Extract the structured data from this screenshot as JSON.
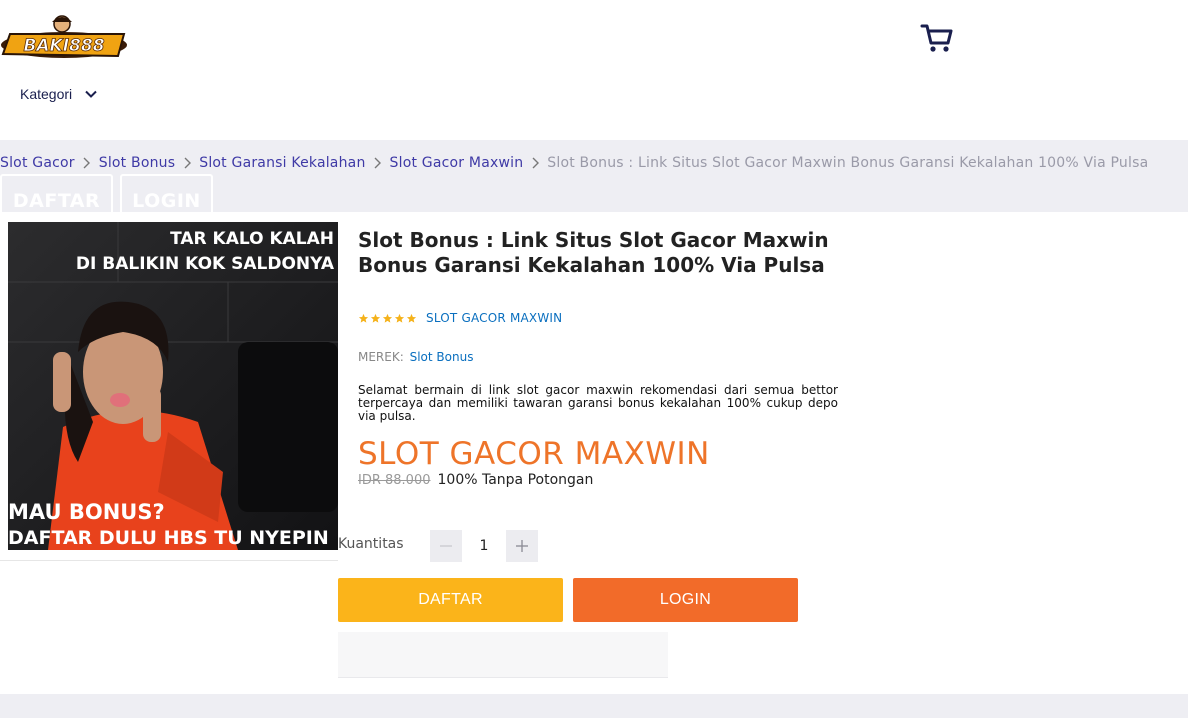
{
  "header": {
    "logo_text": "BAKI888",
    "kategori_label": "Kategori"
  },
  "breadcrumb": {
    "items": [
      "Slot Gacor",
      "Slot Bonus",
      "Slot Garansi Kekalahan",
      "Slot Gacor Maxwin"
    ],
    "current": "Slot Bonus : Link Situs Slot Gacor Maxwin Bonus Garansi Kekalahan 100% Via Pulsa"
  },
  "ghost_buttons": {
    "daftar": "DAFTAR",
    "login": "LOGIN"
  },
  "banner": {
    "top_line1": "TAR KALO KALAH",
    "top_line2": "DI BALIKIN KOK SALDONYA",
    "bottom_line1": "MAU BONUS?",
    "bottom_line2": "DAFTAR DULU HBS TU NYEPIN"
  },
  "product": {
    "title": "Slot Bonus : Link Situs Slot Gacor Maxwin Bonus Garansi Kekalahan 100% Via Pulsa",
    "rating": 5,
    "rating_max": 5,
    "rating_link": "SLOT GACOR MAXWIN",
    "merek_label": "MEREK:",
    "merek_value": "Slot Bonus",
    "description": "Selamat bermain di link slot gacor maxwin rekomendasi dari semua bettor terpercaya dan memiliki tawaran garansi bonus kekalahan 100% cukup depo via pulsa.",
    "price": "SLOT GACOR MAXWIN",
    "old_price": "IDR 88.000",
    "discount_note": "100% Tanpa Potongan"
  },
  "quantity": {
    "label": "Kuantitas",
    "value": "1"
  },
  "actions": {
    "daftar": "DAFTAR",
    "login": "LOGIN"
  },
  "colors": {
    "accent_orange": "#ee7429",
    "daftar_yellow": "#fbb41a",
    "login_orange": "#f26b29",
    "link_blue": "#0a6fbf",
    "breadcrumb_purple": "#3f3aa6",
    "star_gold": "#f5b21b"
  },
  "icons": [
    "cart-icon",
    "chevron-down-icon",
    "chevron-right-icon",
    "star-icon",
    "minus-icon",
    "plus-icon"
  ]
}
